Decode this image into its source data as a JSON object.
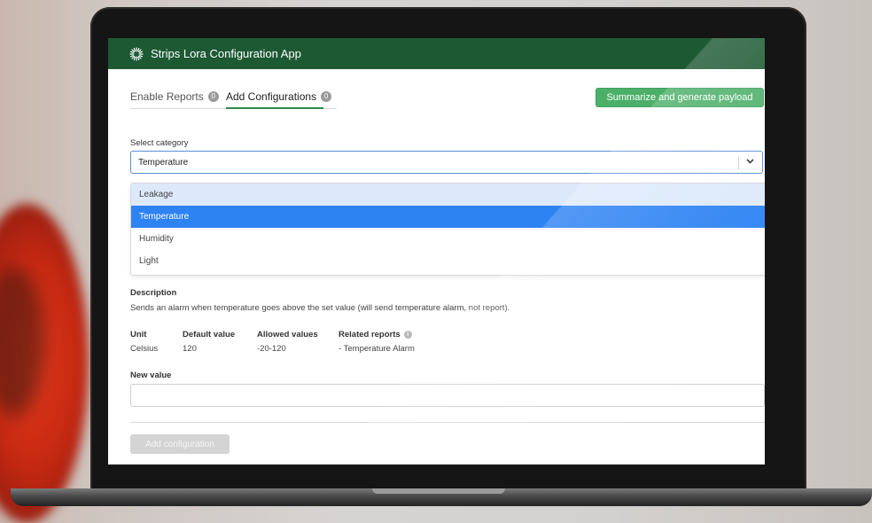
{
  "app": {
    "title": "Strips Lora Configuration App",
    "header_color": "#1d5a34"
  },
  "tabs": [
    {
      "label": "Enable Reports",
      "count": "0",
      "active": false
    },
    {
      "label": "Add Configurations",
      "count": "0",
      "active": true
    }
  ],
  "actions": {
    "summarize_label": "Summarize and generate payload",
    "add_config_label": "Add configuration"
  },
  "category": {
    "label": "Select category",
    "selected_value": "Temperature",
    "options": [
      "Leakage",
      "Temperature",
      "Humidity",
      "Light"
    ],
    "hovered_option": "Leakage"
  },
  "description": {
    "label": "Description",
    "text": "Sends an alarm when temperature goes above the set value (will send temperature alarm, not report)."
  },
  "details": {
    "unit_label": "Unit",
    "unit_value": "Celsius",
    "default_label": "Default value",
    "default_value": "120",
    "allowed_label": "Allowed values",
    "allowed_value": "-20-120",
    "related_label": "Related reports",
    "related_value": "- Temperature Alarm"
  },
  "new_value": {
    "label": "New value",
    "value": "",
    "placeholder": ""
  },
  "colors": {
    "accent_green": "#4caf69",
    "selected_blue": "#2e83f3",
    "focus_border": "#5a8dd8"
  }
}
